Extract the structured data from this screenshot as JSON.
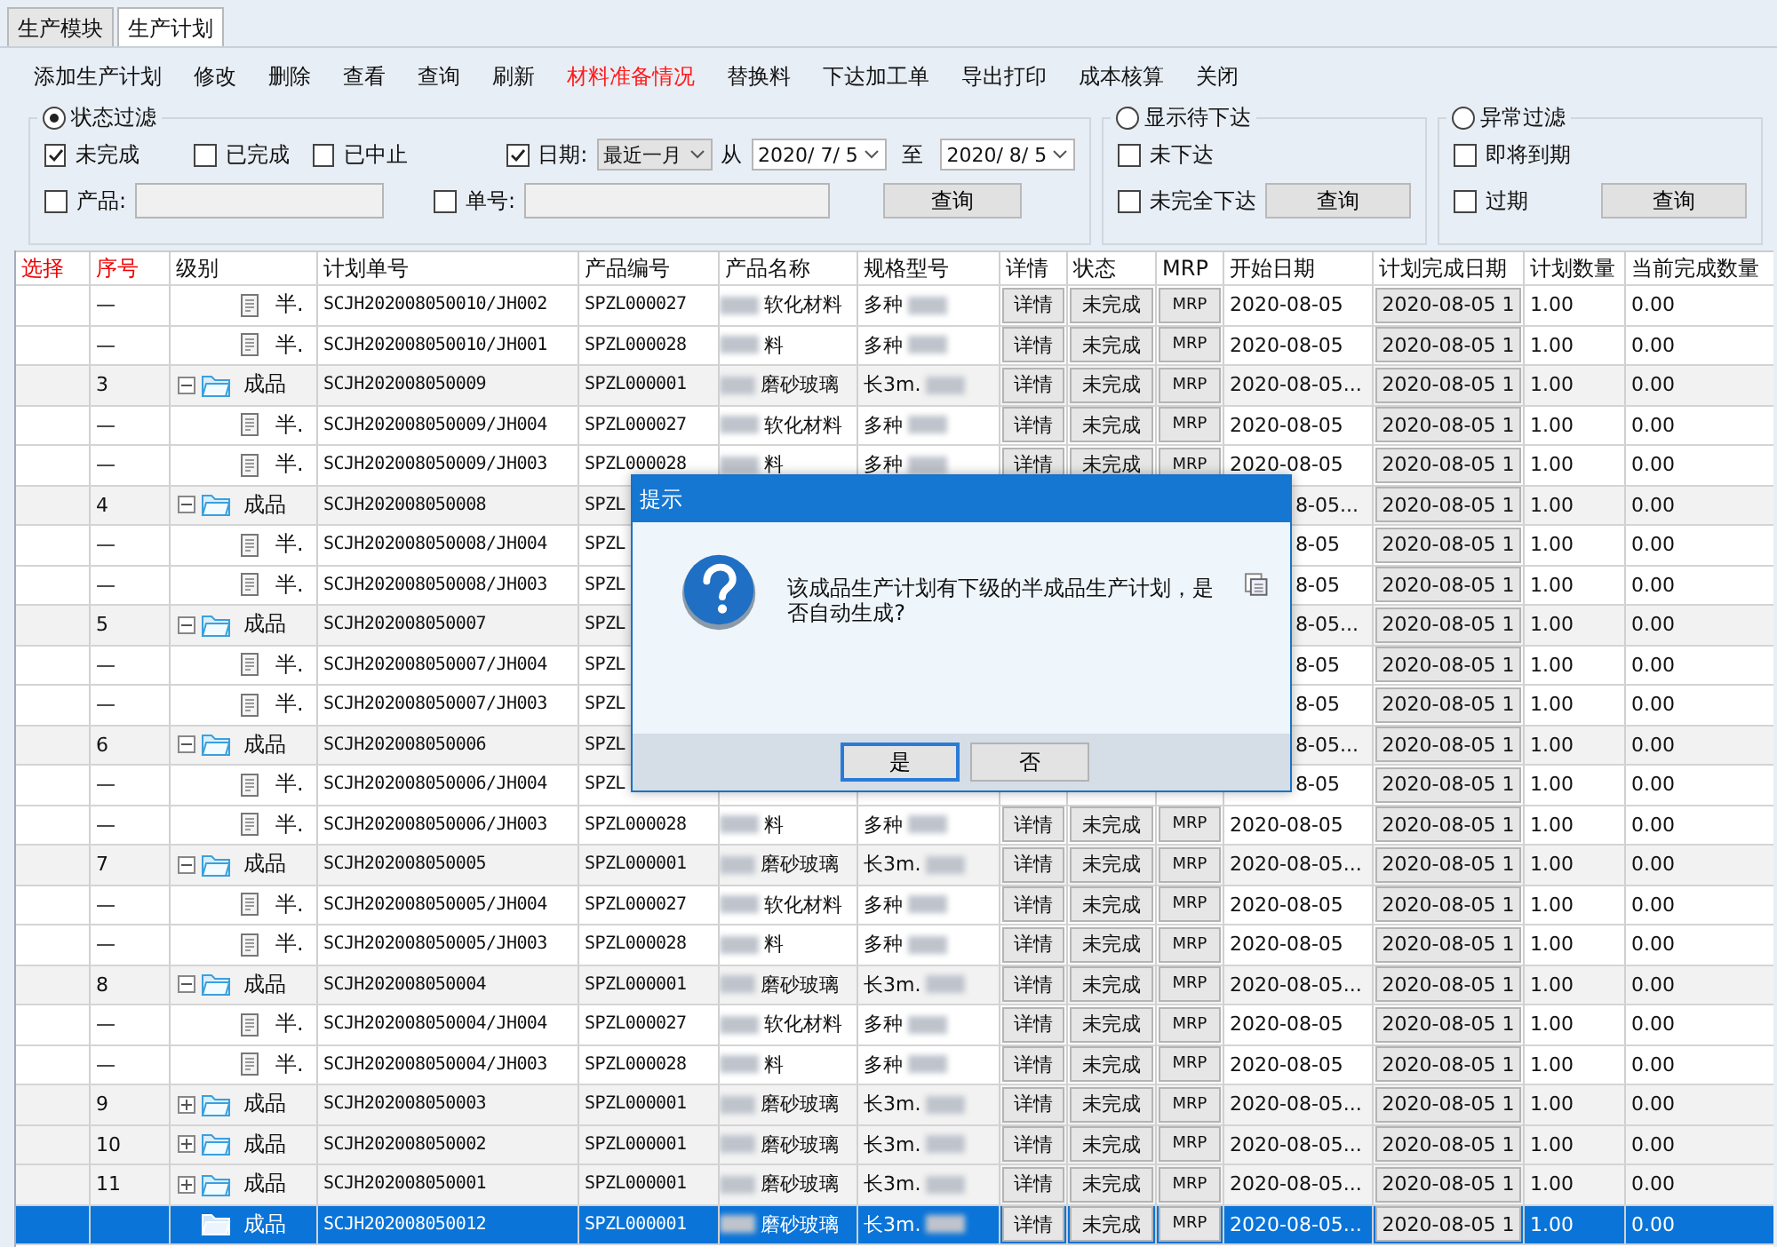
{
  "tabs": [
    {
      "label": "生产模块",
      "selected": false
    },
    {
      "label": "生产计划",
      "selected": true
    }
  ],
  "toolbar": [
    {
      "label": "添加生产计划",
      "highlight": false
    },
    {
      "label": "修改",
      "highlight": false
    },
    {
      "label": "删除",
      "highlight": false
    },
    {
      "label": "查看",
      "highlight": false
    },
    {
      "label": "查询",
      "highlight": false
    },
    {
      "label": "刷新",
      "highlight": false
    },
    {
      "label": "材料准备情况",
      "highlight": true
    },
    {
      "label": "替换料",
      "highlight": false
    },
    {
      "label": "下达加工单",
      "highlight": false
    },
    {
      "label": "导出打印",
      "highlight": false
    },
    {
      "label": "成本核算",
      "highlight": false
    },
    {
      "label": "关闭",
      "highlight": false
    }
  ],
  "status_filter": {
    "title": "状态过滤",
    "selected": true,
    "states": [
      {
        "label": "未完成",
        "checked": true
      },
      {
        "label": "已完成",
        "checked": false
      },
      {
        "label": "已中止",
        "checked": false
      }
    ],
    "date": {
      "label": "日期:",
      "checked": true,
      "range": "最近一月",
      "from_label": "从",
      "from": "2020/ 7/ 5",
      "to_label": "至",
      "to": "2020/ 8/ 5"
    },
    "product": {
      "label": "产品:",
      "checked": false
    },
    "order": {
      "label": "单号:",
      "checked": false
    },
    "button": "查询"
  },
  "release_filter": {
    "title": "显示待下达",
    "selected": false,
    "options": [
      {
        "label": "未下达",
        "checked": false
      },
      {
        "label": "未完全下达",
        "checked": false
      }
    ],
    "button": "查询"
  },
  "exception_filter": {
    "title": "异常过滤",
    "selected": false,
    "options": [
      {
        "label": "即将到期",
        "checked": false
      },
      {
        "label": "过期",
        "checked": false
      }
    ],
    "button": "查询"
  },
  "table": {
    "columns": [
      {
        "label": "选择",
        "red": true
      },
      {
        "label": "序号",
        "red": true
      },
      {
        "label": "级别",
        "red": false
      },
      {
        "label": "计划单号",
        "red": false
      },
      {
        "label": "产品编号",
        "red": false
      },
      {
        "label": "产品名称",
        "red": false
      },
      {
        "label": "规格型号",
        "red": false
      },
      {
        "label": "详情",
        "red": false
      },
      {
        "label": "状态",
        "red": false
      },
      {
        "label": "MRP",
        "red": false
      },
      {
        "label": "开始日期",
        "red": false
      },
      {
        "label": "计划完成日期",
        "red": false
      },
      {
        "label": "计划数量",
        "red": false
      },
      {
        "label": "当前完成数量",
        "red": false
      }
    ],
    "rows": [
      {
        "kind": "child",
        "seq": "—",
        "level": "半.",
        "plan_no": "SCJH202008050010/JH002",
        "code": "SPZL000027",
        "name": "软化材料",
        "spec": "多种",
        "detail": "详情",
        "status": "未完成",
        "mrp": "MRP",
        "start": "2020-08-05",
        "due": "2020-08-05 1",
        "qty": "1.00",
        "done": "0.00",
        "selected": false
      },
      {
        "kind": "child",
        "seq": "—",
        "level": "半.",
        "plan_no": "SCJH202008050010/JH001",
        "code": "SPZL000028",
        "name": "料",
        "spec": "多种",
        "detail": "详情",
        "status": "未完成",
        "mrp": "MRP",
        "start": "2020-08-05",
        "due": "2020-08-05 1",
        "qty": "1.00",
        "done": "0.00",
        "selected": false
      },
      {
        "kind": "parent",
        "expanded": true,
        "seq": "3",
        "level": "成品",
        "plan_no": "SCJH202008050009",
        "code": "SPZL000001",
        "name": "磨砂玻璃",
        "spec": "长3m.",
        "detail": "详情",
        "status": "未完成",
        "mrp": "MRP",
        "start": "2020-08-05...",
        "due": "2020-08-05 1",
        "qty": "1.00",
        "done": "0.00",
        "selected": false
      },
      {
        "kind": "child",
        "seq": "—",
        "level": "半.",
        "plan_no": "SCJH202008050009/JH004",
        "code": "SPZL000027",
        "name": "软化材料",
        "spec": "多种",
        "detail": "详情",
        "status": "未完成",
        "mrp": "MRP",
        "start": "2020-08-05",
        "due": "2020-08-05 1",
        "qty": "1.00",
        "done": "0.00",
        "selected": false
      },
      {
        "kind": "child",
        "seq": "—",
        "level": "半.",
        "plan_no": "SCJH202008050009/JH003",
        "code": "SPZL000028",
        "name": "料",
        "spec": "多种",
        "detail": "详情",
        "status": "未完成",
        "mrp": "MRP",
        "start": "2020-08-05",
        "due": "2020-08-05 1",
        "qty": "1.00",
        "done": "0.00",
        "selected": false
      },
      {
        "kind": "parent",
        "expanded": true,
        "covered": true,
        "seq": "4",
        "level": "成品",
        "plan_no": "SCJH202008050008",
        "code": "SPZL",
        "start": "8-05...",
        "due": "2020-08-05 1",
        "qty": "1.00",
        "done": "0.00",
        "selected": false
      },
      {
        "kind": "child",
        "covered": true,
        "seq": "—",
        "level": "半.",
        "plan_no": "SCJH202008050008/JH004",
        "code": "SPZL",
        "start": "8-05",
        "due": "2020-08-05 1",
        "qty": "1.00",
        "done": "0.00",
        "selected": false
      },
      {
        "kind": "child",
        "covered": true,
        "seq": "—",
        "level": "半.",
        "plan_no": "SCJH202008050008/JH003",
        "code": "SPZL",
        "start": "8-05",
        "due": "2020-08-05 1",
        "qty": "1.00",
        "done": "0.00",
        "selected": false
      },
      {
        "kind": "parent",
        "expanded": true,
        "covered": true,
        "seq": "5",
        "level": "成品",
        "plan_no": "SCJH202008050007",
        "code": "SPZL",
        "start": "8-05...",
        "due": "2020-08-05 1",
        "qty": "1.00",
        "done": "0.00",
        "selected": false
      },
      {
        "kind": "child",
        "covered": true,
        "seq": "—",
        "level": "半.",
        "plan_no": "SCJH202008050007/JH004",
        "code": "SPZL",
        "start": "8-05",
        "due": "2020-08-05 1",
        "qty": "1.00",
        "done": "0.00",
        "selected": false
      },
      {
        "kind": "child",
        "covered": true,
        "seq": "—",
        "level": "半.",
        "plan_no": "SCJH202008050007/JH003",
        "code": "SPZL",
        "start": "8-05",
        "due": "2020-08-05 1",
        "qty": "1.00",
        "done": "0.00",
        "selected": false
      },
      {
        "kind": "parent",
        "expanded": true,
        "covered": true,
        "seq": "6",
        "level": "成品",
        "plan_no": "SCJH202008050006",
        "code": "SPZL",
        "start": "8-05...",
        "due": "2020-08-05 1",
        "qty": "1.00",
        "done": "0.00",
        "selected": false
      },
      {
        "kind": "child",
        "covered": true,
        "seq": "—",
        "level": "半.",
        "plan_no": "SCJH202008050006/JH004",
        "code": "SPZL",
        "start": "8-05",
        "due": "2020-08-05 1",
        "qty": "1.00",
        "done": "0.00",
        "selected": false
      },
      {
        "kind": "child",
        "seq": "—",
        "level": "半.",
        "plan_no": "SCJH202008050006/JH003",
        "code": "SPZL000028",
        "name": "料",
        "spec": "多种",
        "detail": "详情",
        "status": "未完成",
        "mrp": "MRP",
        "start": "2020-08-05",
        "due": "2020-08-05 1",
        "qty": "1.00",
        "done": "0.00",
        "selected": false
      },
      {
        "kind": "parent",
        "expanded": true,
        "seq": "7",
        "level": "成品",
        "plan_no": "SCJH202008050005",
        "code": "SPZL000001",
        "name": "磨砂玻璃",
        "spec": "长3m.",
        "detail": "详情",
        "status": "未完成",
        "mrp": "MRP",
        "start": "2020-08-05...",
        "due": "2020-08-05 1",
        "qty": "1.00",
        "done": "0.00",
        "selected": false
      },
      {
        "kind": "child",
        "seq": "—",
        "level": "半.",
        "plan_no": "SCJH202008050005/JH004",
        "code": "SPZL000027",
        "name": "软化材料",
        "spec": "多种",
        "detail": "详情",
        "status": "未完成",
        "mrp": "MRP",
        "start": "2020-08-05",
        "due": "2020-08-05 1",
        "qty": "1.00",
        "done": "0.00",
        "selected": false
      },
      {
        "kind": "child",
        "seq": "—",
        "level": "半.",
        "plan_no": "SCJH202008050005/JH003",
        "code": "SPZL000028",
        "name": "料",
        "spec": "多种",
        "detail": "详情",
        "status": "未完成",
        "mrp": "MRP",
        "start": "2020-08-05",
        "due": "2020-08-05 1",
        "qty": "1.00",
        "done": "0.00",
        "selected": false
      },
      {
        "kind": "parent",
        "expanded": true,
        "seq": "8",
        "level": "成品",
        "plan_no": "SCJH202008050004",
        "code": "SPZL000001",
        "name": "磨砂玻璃",
        "spec": "长3m.",
        "detail": "详情",
        "status": "未完成",
        "mrp": "MRP",
        "start": "2020-08-05...",
        "due": "2020-08-05 1",
        "qty": "1.00",
        "done": "0.00",
        "selected": false
      },
      {
        "kind": "child",
        "seq": "—",
        "level": "半.",
        "plan_no": "SCJH202008050004/JH004",
        "code": "SPZL000027",
        "name": "软化材料",
        "spec": "多种",
        "detail": "详情",
        "status": "未完成",
        "mrp": "MRP",
        "start": "2020-08-05",
        "due": "2020-08-05 1",
        "qty": "1.00",
        "done": "0.00",
        "selected": false
      },
      {
        "kind": "child",
        "seq": "—",
        "level": "半.",
        "plan_no": "SCJH202008050004/JH003",
        "code": "SPZL000028",
        "name": "料",
        "spec": "多种",
        "detail": "详情",
        "status": "未完成",
        "mrp": "MRP",
        "start": "2020-08-05",
        "due": "2020-08-05 1",
        "qty": "1.00",
        "done": "0.00",
        "selected": false
      },
      {
        "kind": "parent",
        "expanded": false,
        "seq": "9",
        "level": "成品",
        "plan_no": "SCJH202008050003",
        "code": "SPZL000001",
        "name": "磨砂玻璃",
        "spec": "长3m.",
        "detail": "详情",
        "status": "未完成",
        "mrp": "MRP",
        "start": "2020-08-05...",
        "due": "2020-08-05 1",
        "qty": "1.00",
        "done": "0.00",
        "selected": false
      },
      {
        "kind": "parent",
        "expanded": false,
        "seq": "10",
        "level": "成品",
        "plan_no": "SCJH202008050002",
        "code": "SPZL000001",
        "name": "磨砂玻璃",
        "spec": "长3m.",
        "detail": "详情",
        "status": "未完成",
        "mrp": "MRP",
        "start": "2020-08-05...",
        "due": "2020-08-05 1",
        "qty": "1.00",
        "done": "0.00",
        "selected": false
      },
      {
        "kind": "parent",
        "expanded": false,
        "seq": "11",
        "level": "成品",
        "plan_no": "SCJH202008050001",
        "code": "SPZL000001",
        "name": "磨砂玻璃",
        "spec": "长3m.",
        "detail": "详情",
        "status": "未完成",
        "mrp": "MRP",
        "start": "2020-08-05...",
        "due": "2020-08-05 1",
        "qty": "1.00",
        "done": "0.00",
        "selected": false
      },
      {
        "kind": "leaf",
        "level": "成品",
        "plan_no": "SCJH202008050012",
        "code": "SPZL000001",
        "name": "磨砂玻璃",
        "spec": "长3m.",
        "detail": "详情",
        "status": "未完成",
        "mrp": "MRP",
        "start": "2020-08-05...",
        "due": "2020-08-05 1",
        "qty": "1.00",
        "done": "0.00",
        "selected": true
      }
    ]
  },
  "dialog": {
    "title": "提示",
    "message": "该成品生产计划有下级的半成品生产计划，是否自动生成?",
    "buttons": [
      {
        "label": "是",
        "focused": true
      },
      {
        "label": "否",
        "focused": false
      }
    ]
  }
}
